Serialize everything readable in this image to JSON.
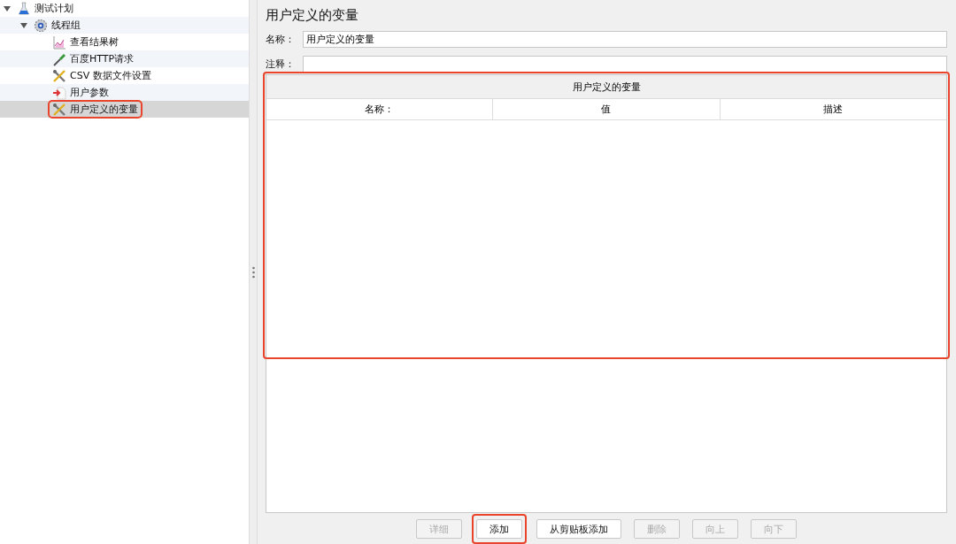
{
  "tree": [
    {
      "label": "测试计划",
      "kind": "plan",
      "expanded": true,
      "selected": false,
      "highlighted": false,
      "children": [
        {
          "label": "线程组",
          "kind": "threads",
          "expanded": true,
          "selected": false,
          "highlighted": false,
          "children": [
            {
              "label": "查看结果树",
              "kind": "listener",
              "selected": false,
              "highlighted": false
            },
            {
              "label": "百度HTTP请求",
              "kind": "sampler",
              "selected": false,
              "highlighted": false
            },
            {
              "label": "CSV 数据文件设置",
              "kind": "config",
              "selected": false,
              "highlighted": false
            },
            {
              "label": "用户参数",
              "kind": "preprocessor",
              "selected": false,
              "highlighted": false
            },
            {
              "label": "用户定义的变量",
              "kind": "config",
              "selected": true,
              "highlighted": true
            }
          ]
        }
      ]
    }
  ],
  "panel": {
    "title": "用户定义的变量",
    "fields": [
      {
        "label": "名称：",
        "value": "用户定义的变量"
      },
      {
        "label": "注释："
      }
    ],
    "table": {
      "title": "用户定义的变量",
      "highlighted": true,
      "columns": [
        "名称：",
        "值",
        "描述"
      ]
    },
    "buttons": [
      {
        "label": "详细",
        "disabled": true,
        "highlighted": false
      },
      {
        "label": "添加",
        "disabled": false,
        "highlighted": true
      },
      {
        "label": "从剪贴板添加",
        "disabled": false,
        "highlighted": false
      },
      {
        "label": "删除",
        "disabled": true,
        "highlighted": false
      },
      {
        "label": "向上",
        "disabled": true,
        "highlighted": false
      },
      {
        "label": "向下",
        "disabled": true,
        "highlighted": false
      }
    ]
  }
}
